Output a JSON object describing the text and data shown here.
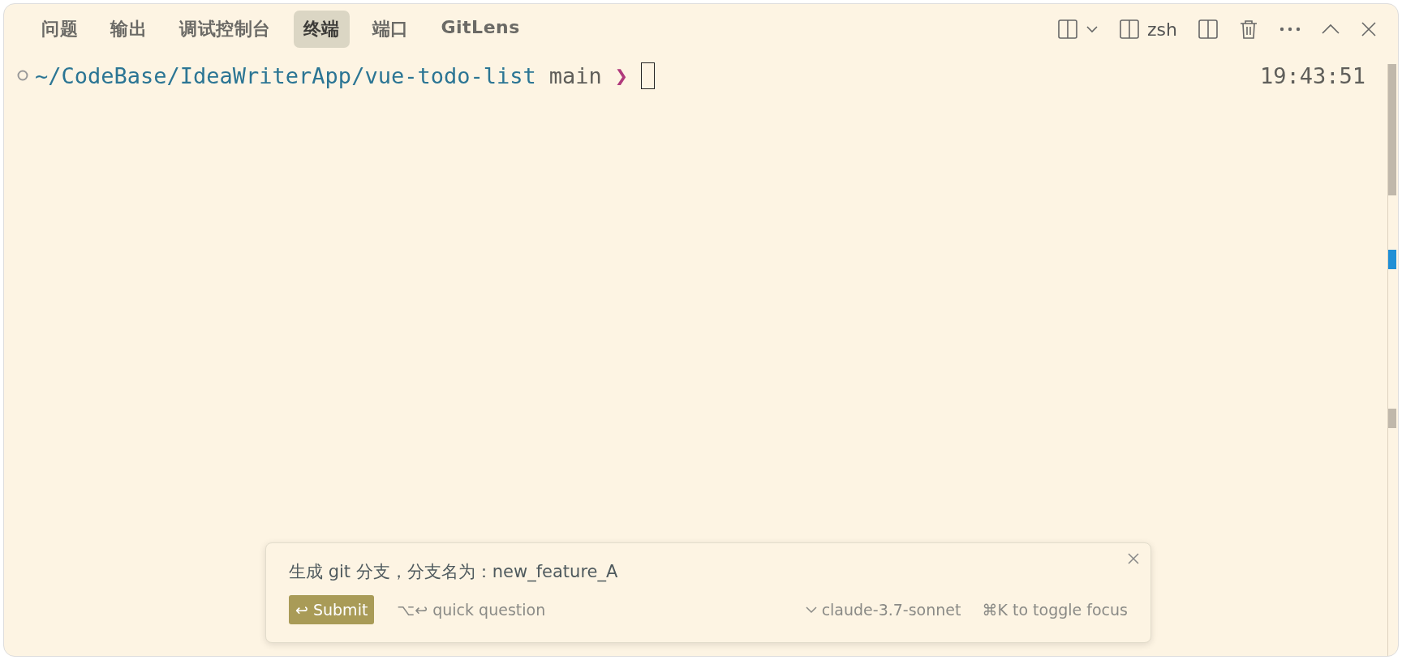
{
  "tabs": [
    {
      "label": "问题",
      "selected": false
    },
    {
      "label": "输出",
      "selected": false
    },
    {
      "label": "调试控制台",
      "selected": false
    },
    {
      "label": "终端",
      "selected": true
    },
    {
      "label": "端口",
      "selected": false
    },
    {
      "label": "GitLens",
      "selected": false
    }
  ],
  "toolbar": {
    "terminal_name": "zsh"
  },
  "terminal": {
    "cwd": "~/CodeBase/IdeaWriterApp/vue-todo-list",
    "branch": "main",
    "prompt": "❯",
    "time": "19:43:51"
  },
  "inline_chat": {
    "value": "生成 git 分支，分支名为：new_feature_A",
    "submit": "↩ Submit",
    "hint": "⌥↩ quick question",
    "model": "claude-3.7-sonnet",
    "shortcut": "⌘K to toggle focus"
  }
}
